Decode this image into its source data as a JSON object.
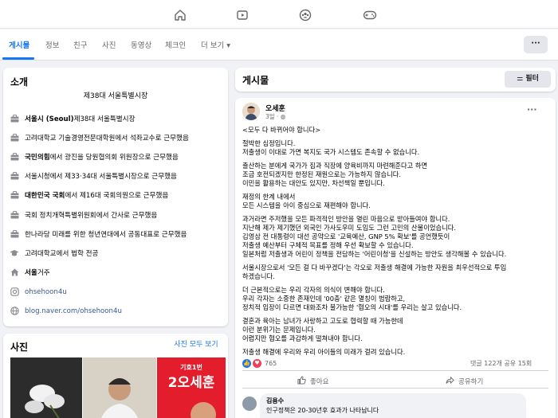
{
  "topnav": {
    "icons": [
      "home-icon",
      "video-icon",
      "groups-icon",
      "gaming-icon"
    ]
  },
  "tabs": [
    {
      "label": "게시물",
      "active": true
    },
    {
      "label": "정보"
    },
    {
      "label": "친구"
    },
    {
      "label": "사진"
    },
    {
      "label": "동영상"
    },
    {
      "label": "체크인"
    },
    {
      "label": "더 보기 ▾"
    }
  ],
  "more_button": "···",
  "intro": {
    "title": "소개",
    "bio": "제38대 서울특별시장",
    "items": [
      {
        "icon": "briefcase-icon",
        "bold": "서울시 (Seoul)",
        "text": " 제38대 서울특별시장"
      },
      {
        "icon": "briefcase-icon",
        "bold": "",
        "text": "고려대학교 기술경영전문대학원에서 석좌교수로 근무했음"
      },
      {
        "icon": "briefcase-icon",
        "bold": "국민의힘",
        "text": "에서 광진을 당원협의회 위원장으로 근무했음"
      },
      {
        "icon": "briefcase-icon",
        "bold": "",
        "text": "서울시청에서 제33·34대 서울특별시장으로 근무했음"
      },
      {
        "icon": "briefcase-icon",
        "bold": "대한민국 국회",
        "text": "에서 제16대 국회의원으로 근무했음"
      },
      {
        "icon": "briefcase-icon",
        "bold": "",
        "text": "국회 정치개혁특별위원회에서 간사로 근무했음"
      },
      {
        "icon": "briefcase-icon",
        "bold": "",
        "text": "한나라당 미래를 위한 청년연대에서 공동대표로 근무했음"
      },
      {
        "icon": "graduation-cap-icon",
        "bold": "",
        "text": "고려대학교에서 법학 전공"
      },
      {
        "icon": "home-icon",
        "bold": "서울",
        "text": " 거주"
      },
      {
        "icon": "instagram-icon",
        "bold": "",
        "text": "ohsehoon4u",
        "link": true
      },
      {
        "icon": "globe-icon",
        "bold": "",
        "text": "blog.naver.com/ohsehoon4u",
        "link": true
      }
    ]
  },
  "photos": {
    "title": "사진",
    "see_all": "사진 모두 보기",
    "poster_small": "기호1번",
    "poster_big": "2오세훈"
  },
  "posts_header": {
    "title": "게시물",
    "filter": "필터"
  },
  "post": {
    "author": "오세훈",
    "date": "3일 · ",
    "lines": [
      "<모두 다 바뀌어야 합니다>",
      "",
      "절박한 심정입니다.",
      "저출생이 이대로 가면 복지도 국가 시스템도 존속할 수 없습니다.",
      "",
      "출산하는 분에게 국가가 집과 직장에 양육비까지 마련해준다고 하면",
      "조금 호전되겠지만 한정된 재원으로는 가능하지 않습니다.",
      "이민을 활용하는 대안도 있지만, 차선책일 뿐입니다.",
      "",
      "재정의 한계 내에서",
      "모든 시스템을 아이 중심으로 재편해야 합니다.",
      "",
      "과거라면 주저했을 모든 파격적인 방안을 열린 마음으로 받아들여야 합니다.",
      "지난해 제가 제기했던 외국인 가사도우미 도입도 그런 고민의 산물이었습니다.",
      "김영삼 전 대통령이 대선 공약으로 '교육예산, GNP 5% 확보'를 공언했듯이",
      "저출생 예산부터 구체적 목표를 정해 우선 확보할 수 있습니다.",
      "일본처럼 저출생과 어린이 정책을 전담하는 '어린이청'을 신설하는 방안도 생각해볼 수 있습니다.",
      "",
      "서울시장으로서 '모든 걸 다 바꾸겠다'는 각오로 저출생 해결에 가능한 자원을 최우선적으로 투입",
      "하겠습니다.",
      "",
      "더 근본적으로는 우리 각자의 의식이 변해야 합니다.",
      "우리 각자는 소중한 존재인데 '00충' 같은 멸칭이 범람하고,",
      "정치적 입장이 다르면 대화조차 불가능한 '혐오의 시대'를 우리는 살고 있습니다.",
      "",
      "결혼과 육아는 남녀가 사랑하고 고도로 협력할 때 가능한데",
      "이런 분위기는 문제입니다.",
      "어렵지만 혐오를 과감하게 떨쳐내야 합니다.",
      "",
      "저출생 해결에 우리와 우리 아이들의 미래가 걸려 있습니다."
    ],
    "reactions": "765",
    "comments_shares": "댓글 122개   공유 15회",
    "like": "좋아요",
    "share": "공유하기",
    "comment": {
      "name": "김용수",
      "text": "인구정책은 20-30년후 효과가 나타납니다"
    }
  }
}
